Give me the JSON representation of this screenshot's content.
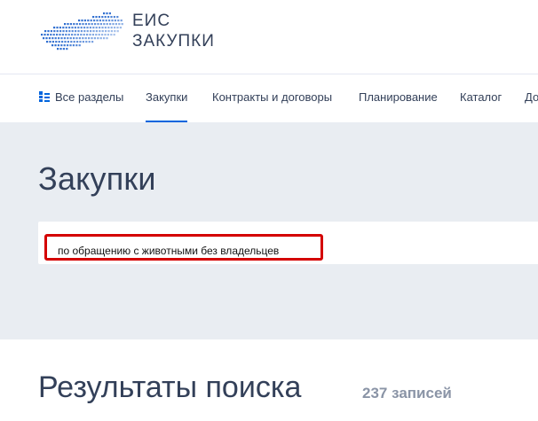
{
  "header": {
    "logo_line1": "ЕИС",
    "logo_line2": "ЗАКУПКИ"
  },
  "nav": {
    "items": [
      {
        "label": "Все разделы"
      },
      {
        "label": "Закупки"
      },
      {
        "label": "Контракты и договоры"
      },
      {
        "label": "Планирование"
      },
      {
        "label": "Каталог"
      },
      {
        "label": "До"
      }
    ],
    "active": "Закупки"
  },
  "main": {
    "title": "Закупки",
    "search_value": "по обращению с животными без владельцев"
  },
  "results": {
    "title": "Результаты поиска",
    "count": "237 записей"
  },
  "colors": {
    "accent": "#0065dd",
    "highlight": "#d40000",
    "hero_bg": "#e9edf2",
    "text": "#334059"
  }
}
